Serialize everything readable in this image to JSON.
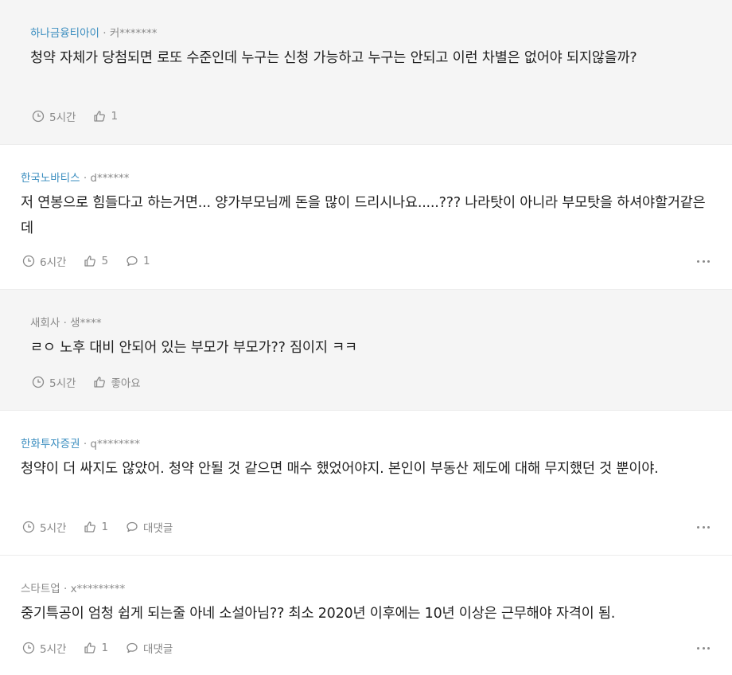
{
  "comments": [
    {
      "company": "하나금융티아이",
      "author": "· 커*******",
      "text": "청약 자체가 당첨되면 로또 수준인데 누구는 신청 가능하고 누구는 안되고 이런 차별은 없어야 되지않을까?",
      "time": "5시간",
      "likes": "1"
    },
    {
      "company": "한국노바티스",
      "author": "· d******",
      "text": "저 연봉으로 힘들다고 하는거면... 양가부모님께 돈을 많이 드리시나요.....??? 나라탓이 아니라 부모탓을 하셔야할거같은데",
      "time": "6시간",
      "likes": "5",
      "replies": "1"
    },
    {
      "company": "새회사",
      "author": "· 생****",
      "text": "ㄹㅇ 노후 대비 안되어 있는 부모가 부모가?? 짐이지 ㅋㅋ",
      "time": "5시간",
      "likes": "좋아요"
    },
    {
      "company": "한화투자증권",
      "author": "· q********",
      "text": "청약이 더 싸지도 않았어. 청약 안될 것 같으면 매수 했었어야지. 본인이 부동산 제도에 대해 무지했던 것 뿐이야.",
      "time": "5시간",
      "likes": "1",
      "replies": "대댓글"
    },
    {
      "company": "스타트업",
      "author": "· x*********",
      "text": "중기특공이 엄청 쉽게 되는줄 아네 소설아님?? 최소 2020년 이후에는 10년 이상은 근무해야 자격이 됨.",
      "time": "5시간",
      "likes": "1",
      "replies": "대댓글"
    }
  ]
}
